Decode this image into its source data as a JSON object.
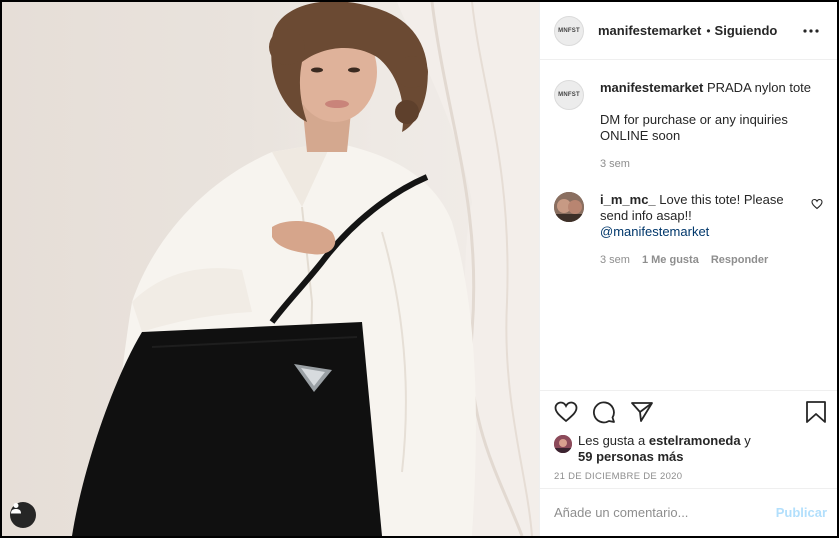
{
  "post": {
    "account": "manifestemarket",
    "avatar_text": "MNFST",
    "follow_separator": "•",
    "follow_status": "Siguiendo",
    "caption_line1": "PRADA nylon tote",
    "caption_line2": "DM for purchase or any inquiries ONLINE soon",
    "caption_time": "3 sem"
  },
  "comments": [
    {
      "user": "i_m_mc_",
      "text": "Love this tote! Please send info asap!!",
      "mention": "@manifestemarket",
      "time": "3 sem",
      "likes": "1 Me gusta",
      "reply": "Responder"
    }
  ],
  "likes": {
    "prefix": "Les gusta a",
    "user": "estelramoneda",
    "conj": "y",
    "others": "59 personas más"
  },
  "date": "21 DE DICIEMBRE DE 2020",
  "comment_input": {
    "placeholder": "Añade un comentario...",
    "post_label": "Publicar"
  },
  "icons": {
    "more": "more-options-icon",
    "like": "heart-icon",
    "comment": "comment-icon",
    "share": "share-icon",
    "save": "bookmark-icon",
    "tag": "user-tag-icon"
  },
  "colors": {
    "link": "#00376b",
    "muted": "#8e8e8e",
    "post_disabled": "#b2dffc",
    "text": "#262626"
  }
}
